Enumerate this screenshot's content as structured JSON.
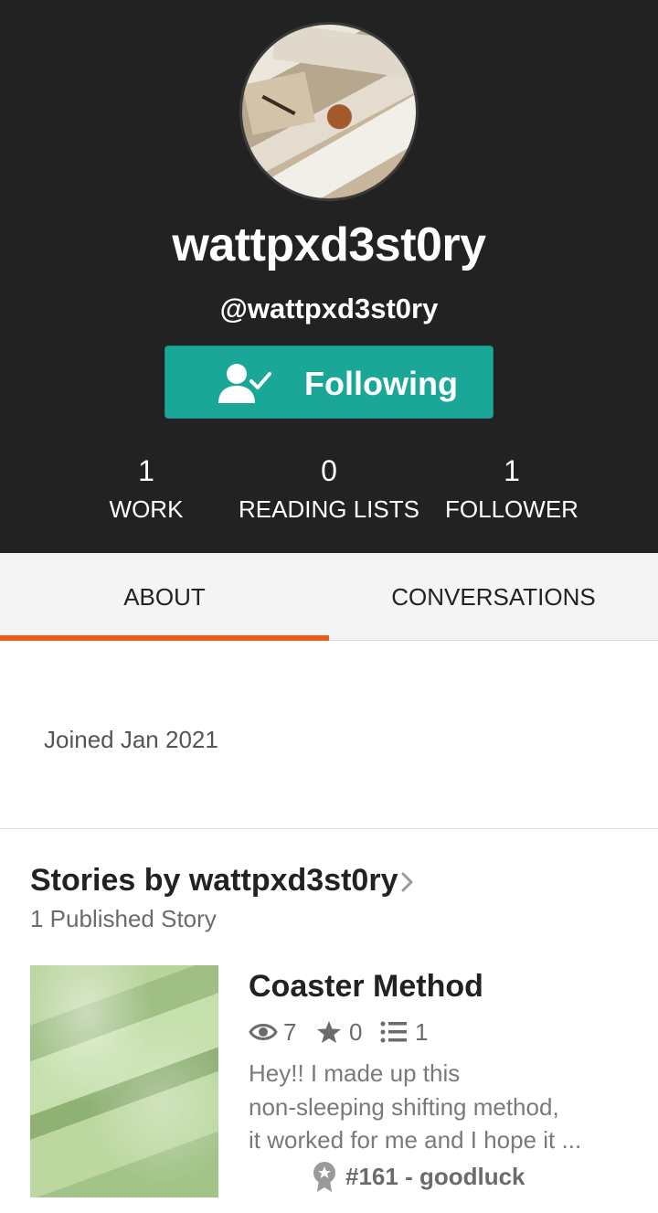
{
  "profile": {
    "display_name": "wattpxd3st0ry",
    "handle": "@wattpxd3st0ry",
    "follow_button_label": "Following",
    "accent_color": "#1ba797"
  },
  "stats": [
    {
      "value": "1",
      "label": "WORK"
    },
    {
      "value": "0",
      "label": "READING LISTS"
    },
    {
      "value": "1",
      "label": "FOLLOWER"
    }
  ],
  "tabs": [
    {
      "label": "ABOUT",
      "active": true
    },
    {
      "label": "CONVERSATIONS",
      "active": false
    }
  ],
  "tab_indicator_color": "#ee5b1a",
  "about": {
    "joined": "Joined Jan 2021"
  },
  "stories_section": {
    "title": "Stories by wattpxd3st0ry",
    "count_label": "1 Published Story"
  },
  "story": {
    "title": "Coaster Method",
    "reads": "7",
    "votes": "0",
    "parts": "1",
    "description_lines": [
      "Hey!! I made up this",
      "non-sleeping shifting method,",
      "it worked for me and I hope it ..."
    ],
    "rank": "#161 - goodluck"
  }
}
